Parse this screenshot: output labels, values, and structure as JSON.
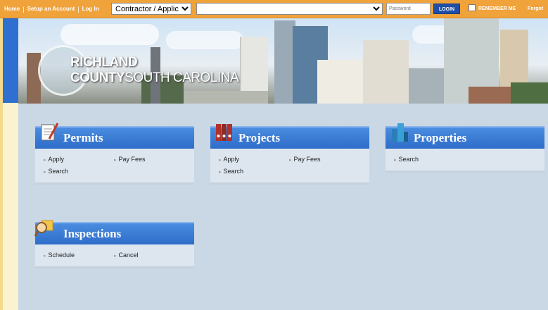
{
  "topbar": {
    "home": "Home",
    "setup": "Setup an Account",
    "login_link": "Log In",
    "role_selected": "Contractor / Applicant",
    "user_selected": "",
    "password_placeholder": "Password",
    "login_button": "LOGIN",
    "remember": "REMEMBER ME",
    "forgot": "Forgot"
  },
  "banner": {
    "line1": "RICHLAND",
    "line2a": "COUNTY",
    "line2b": "SOUTH CAROLINA"
  },
  "cards": {
    "permits": {
      "title": "Permits",
      "links": [
        "Apply",
        "Pay Fees",
        "Search"
      ]
    },
    "projects": {
      "title": "Projects",
      "links": [
        "Apply",
        "Pay Fees",
        "Search"
      ]
    },
    "properties": {
      "title": "Properties",
      "links": [
        "Search"
      ]
    },
    "inspections": {
      "title": "Inspections",
      "links": [
        "Schedule",
        "Cancel"
      ]
    }
  },
  "colors": {
    "topbar": "#f0a23b",
    "card_header": "#2e6cc9",
    "main_bg": "#cad7e5"
  }
}
